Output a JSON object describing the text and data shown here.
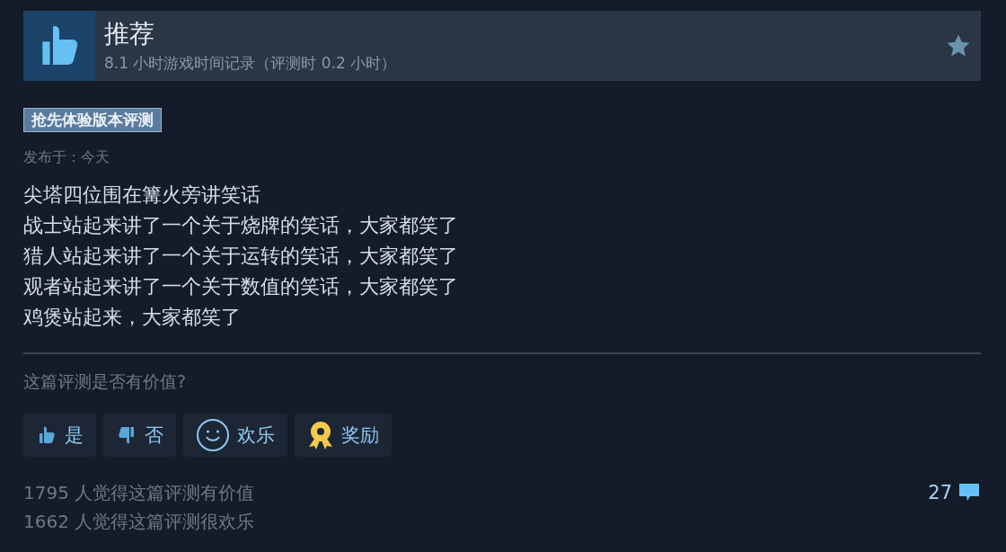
{
  "review": {
    "verdict": "推荐",
    "recommended": true,
    "playtime": "8.1 小时游戏时间记录（评测时 0.2 小时）",
    "badge": "抢先体验版本评测",
    "posted": "发布于：今天",
    "lines": [
      "尖塔四位围在篝火旁讲笑话",
      "战士站起来讲了一个关于烧牌的笑话，大家都笑了",
      "猎人站起来讲了一个关于运转的笑话，大家都笑了",
      "观者站起来讲了一个关于数值的笑话，大家都笑了",
      "鸡煲站起来，大家都笑了"
    ]
  },
  "feedback": {
    "question": "这篇评测是否有价值?",
    "buttons": [
      {
        "kind": "up",
        "label": "是"
      },
      {
        "kind": "down",
        "label": "否"
      },
      {
        "kind": "funny",
        "label": "欢乐"
      },
      {
        "kind": "award",
        "label": "奖励"
      }
    ],
    "stats": [
      "1795 人觉得这篇评测有价值",
      "1662 人觉得这篇评测很欢乐"
    ],
    "comments": "27"
  }
}
